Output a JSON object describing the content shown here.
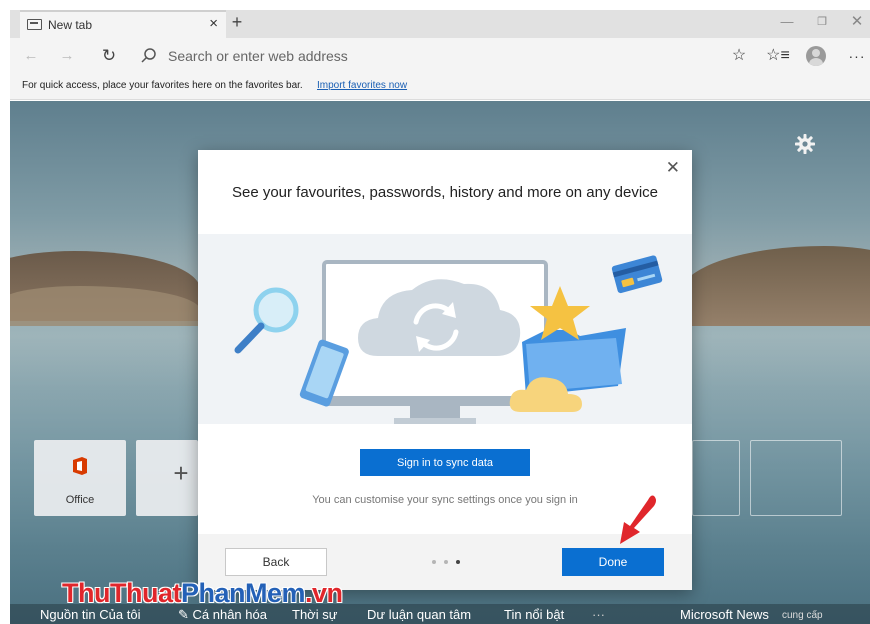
{
  "tab": {
    "title": "New tab",
    "close_glyph": "×",
    "new_glyph": "+"
  },
  "window_controls": {
    "minimize": "—",
    "maximize": "❐",
    "close": "✕"
  },
  "nav": {
    "back_glyph": "←",
    "forward_glyph": "→",
    "refresh_glyph": "↻",
    "address_placeholder": "Search or enter web address",
    "favorite_glyph": "☆",
    "favorites_list_glyph": "☆≡",
    "more_glyph": "···"
  },
  "favorites_bar": {
    "text": "For quick access, place your favorites here on the favorites bar.",
    "link": "Import favorites now"
  },
  "tiles": [
    {
      "label": "Office",
      "icon": "office-icon"
    },
    {
      "label": "+",
      "icon": "add-icon"
    }
  ],
  "modal": {
    "close_glyph": "✕",
    "title": "See your favourites, passwords, history and more on any device",
    "sign_in_label": "Sign in to sync data",
    "note": "You can customise your sync settings once you sign in",
    "back_label": "Back",
    "done_label": "Done",
    "page_count": 3,
    "current_page": 3
  },
  "watermark": {
    "part1": "ThuThuat",
    "part2": "PhanMem",
    "part3": ".vn"
  },
  "news_nav": {
    "items": [
      "Nguồn tin Của tôi",
      "✎ Cá nhân hóa",
      "Thời sự",
      "Dư luận quan tâm",
      "Tin nổi bật",
      "···"
    ],
    "provider": "Microsoft News",
    "provider_suffix": "cung cấp"
  },
  "colors": {
    "accent": "#0a6fd1",
    "link": "#1a5fb4",
    "arrow": "#e0262b"
  }
}
